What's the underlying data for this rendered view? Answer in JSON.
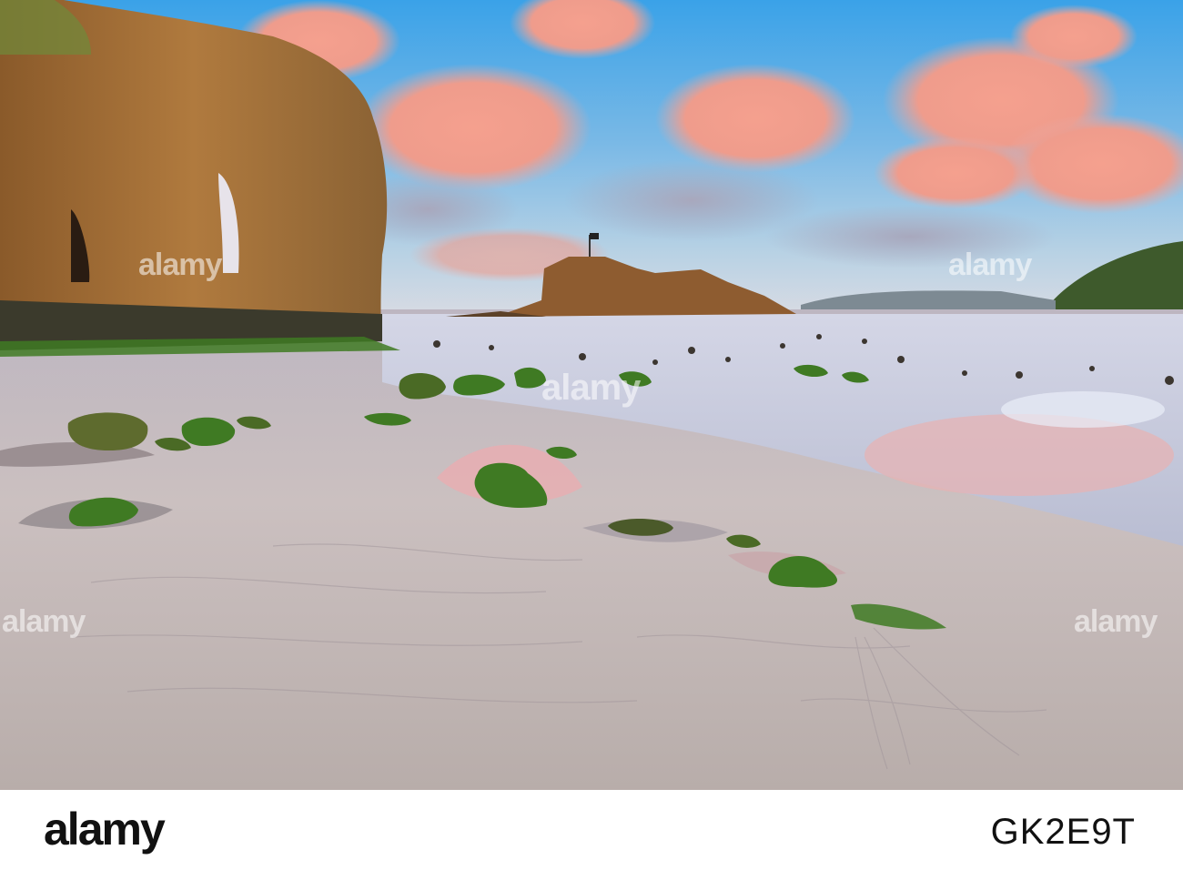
{
  "watermark": {
    "text": "alamy"
  },
  "footer": {
    "brand": "alamy",
    "image_id": "GK2E9T"
  },
  "colors": {
    "sky_top": "#3fa4e6",
    "sky_low": "#9fc7e6",
    "cloud_pink": "#f2a08c",
    "cliff": "#9b6a35",
    "sand": "#c8bdbd",
    "wet_sand": "#b7b4c4",
    "algae": "#3f7a23"
  }
}
